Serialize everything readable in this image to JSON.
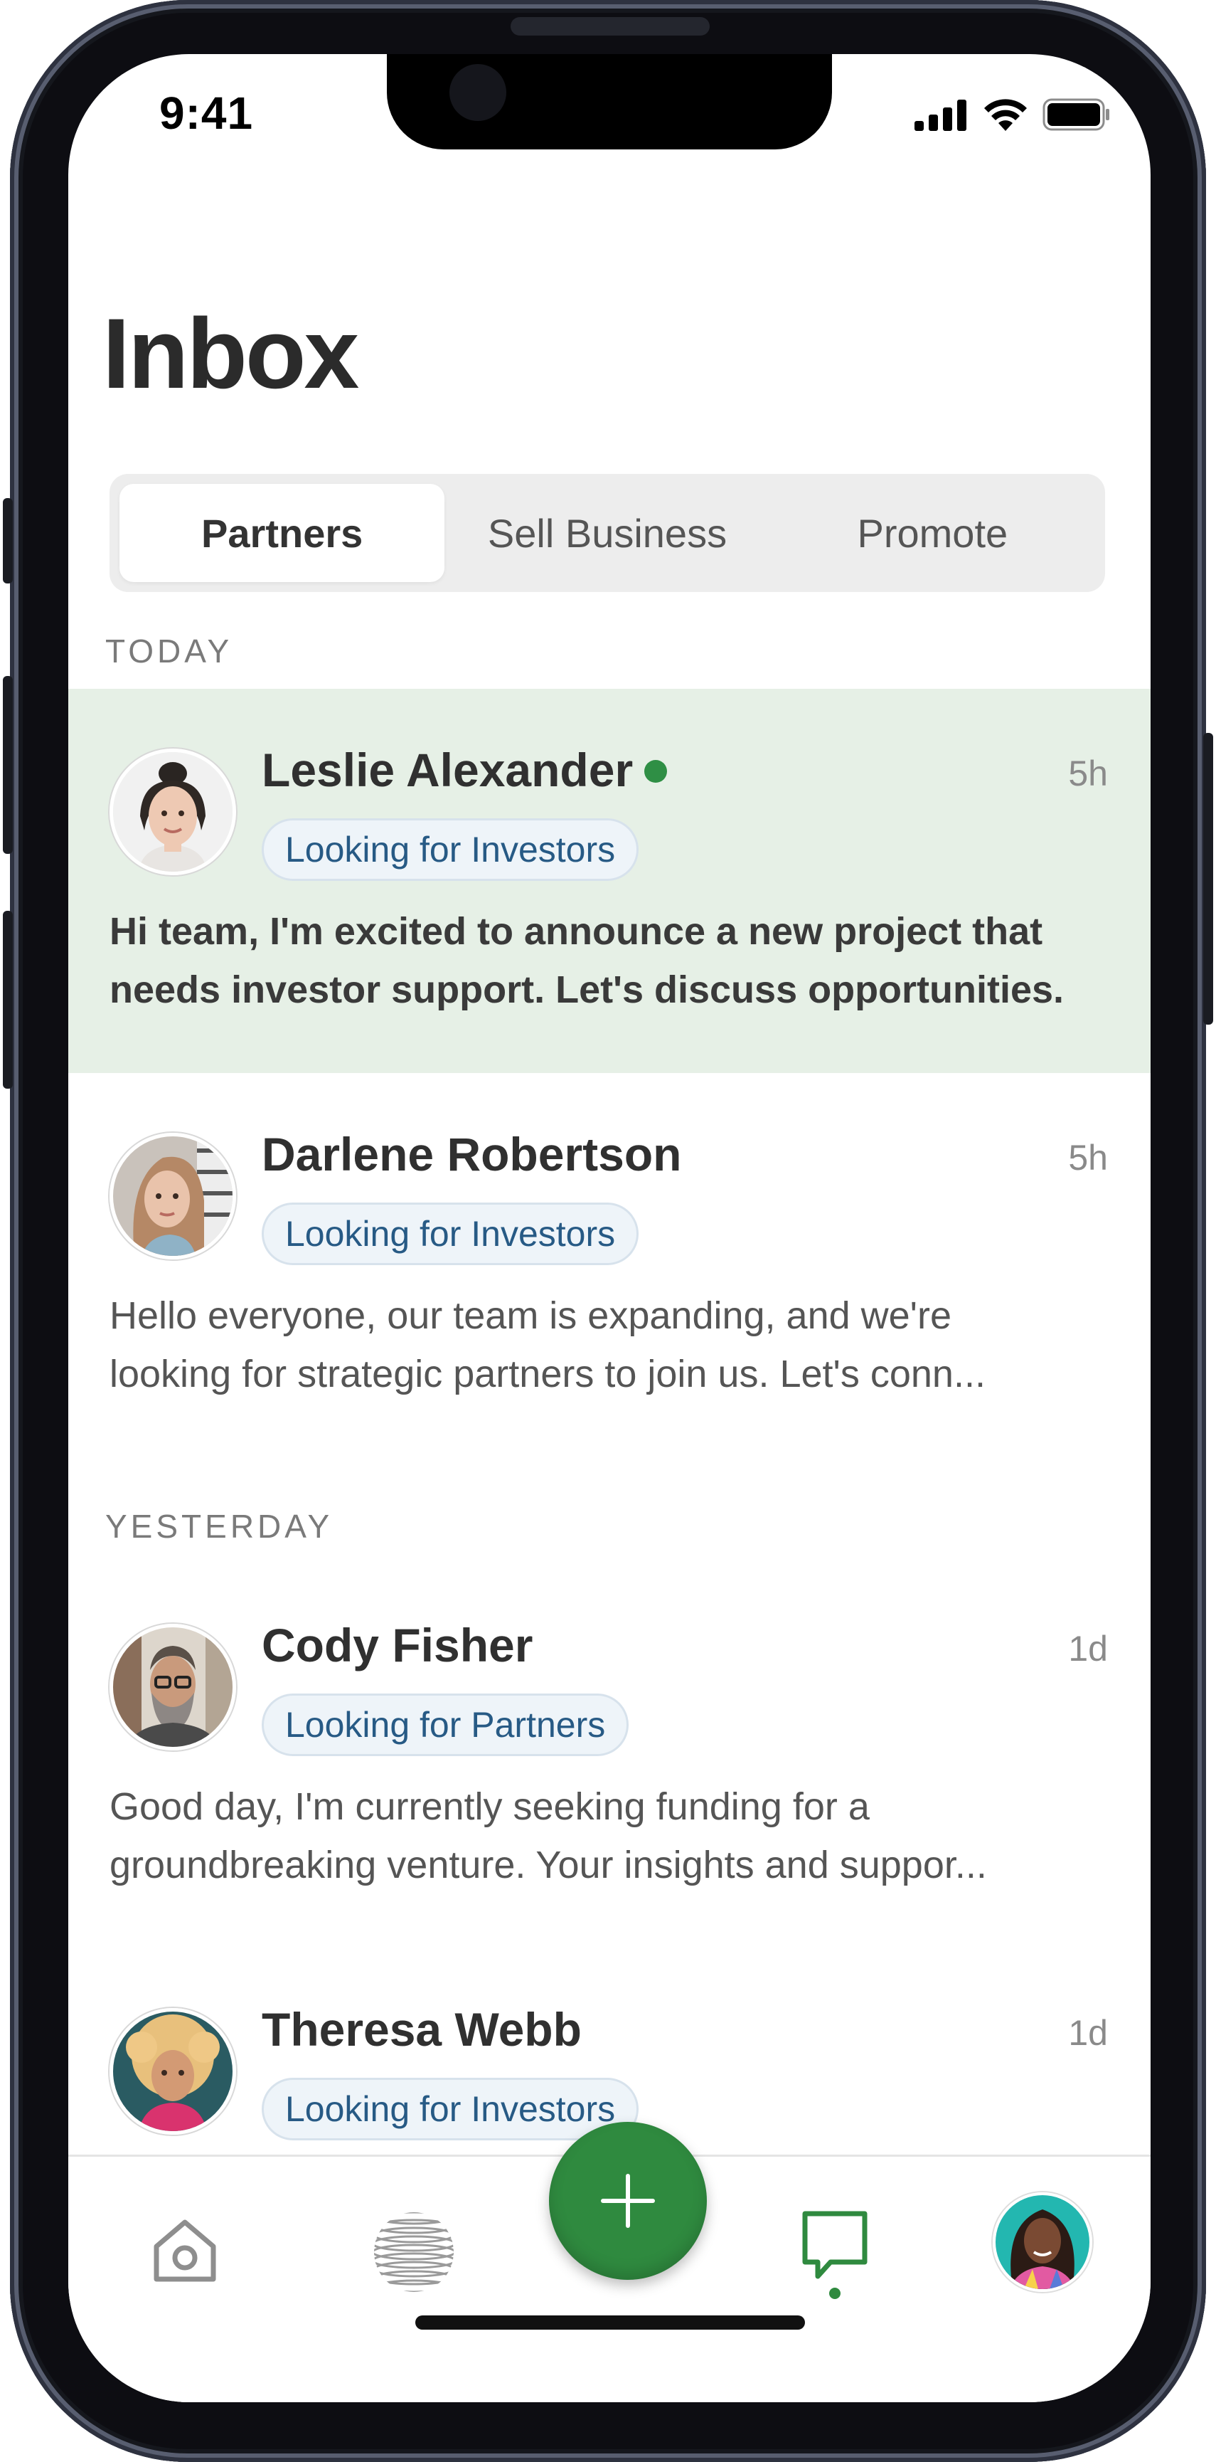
{
  "status_bar": {
    "time": "9:41"
  },
  "header": {
    "title": "Inbox"
  },
  "segments": [
    {
      "label": "Partners",
      "active": true
    },
    {
      "label": "Sell Business",
      "active": false
    },
    {
      "label": "Promote",
      "active": false
    }
  ],
  "sections": {
    "today": "TODAY",
    "yesterday": "YESTERDAY"
  },
  "messages": [
    {
      "name": "Leslie Alexander",
      "online": true,
      "time": "5h",
      "tag": "Looking for Investors",
      "line1": "Hi team, I'm excited to announce a new project that",
      "line2": "needs investor support. Let's discuss opportunities.",
      "unread": true
    },
    {
      "name": "Darlene Robertson",
      "online": false,
      "time": "5h",
      "tag": "Looking for Investors",
      "line1": "Hello everyone, our team is expanding, and we're",
      "line2": "looking for strategic partners to join us. Let's conn...",
      "unread": false
    },
    {
      "name": "Cody Fisher",
      "online": false,
      "time": "1d",
      "tag": "Looking for Partners",
      "line1": "Good day, I'm currently seeking funding for a",
      "line2": "groundbreaking venture. Your insights and suppor...",
      "unread": false
    },
    {
      "name": "Theresa Webb",
      "online": false,
      "time": "1d",
      "tag": "Looking for Investors",
      "line1": "",
      "line2": "",
      "unread": false
    }
  ],
  "tab_bar": {
    "items": [
      {
        "icon": "home-icon",
        "active": false
      },
      {
        "icon": "globe-icon",
        "active": false
      },
      {
        "icon": "plus-icon",
        "active": false
      },
      {
        "icon": "chat-bubble-icon",
        "active": true
      },
      {
        "icon": "profile-avatar",
        "active": false
      }
    ]
  },
  "colors": {
    "accent": "#2f8a3f",
    "highlight_bg": "#e6f0e6",
    "tag_text": "#275a85",
    "tag_bg": "#eef4f9"
  }
}
